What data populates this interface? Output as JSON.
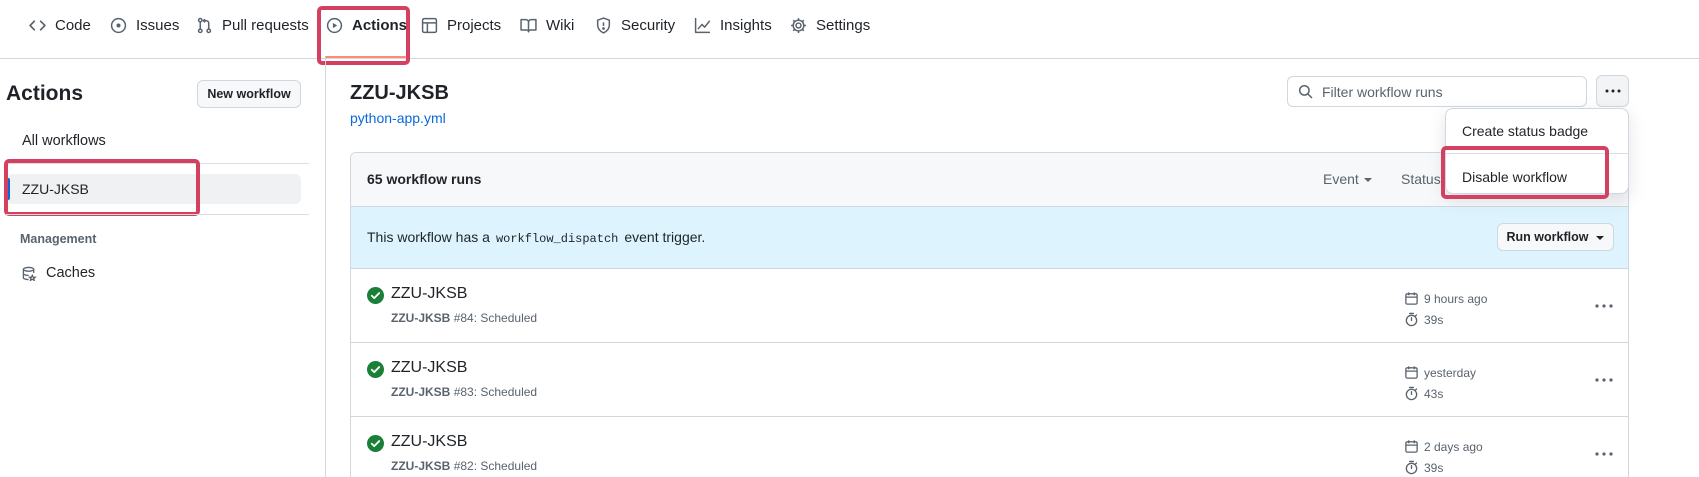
{
  "nav": {
    "tabs": [
      {
        "label": "Code",
        "icon": "code-icon"
      },
      {
        "label": "Issues",
        "icon": "issue-opened-icon"
      },
      {
        "label": "Pull requests",
        "icon": "git-pull-request-icon"
      },
      {
        "label": "Actions",
        "icon": "play-icon",
        "selected": true
      },
      {
        "label": "Projects",
        "icon": "table-icon"
      },
      {
        "label": "Wiki",
        "icon": "book-icon"
      },
      {
        "label": "Security",
        "icon": "shield-icon"
      },
      {
        "label": "Insights",
        "icon": "graph-icon"
      },
      {
        "label": "Settings",
        "icon": "gear-icon"
      }
    ]
  },
  "sidebar": {
    "title": "Actions",
    "new_workflow_label": "New workflow",
    "all_workflows_label": "All workflows",
    "workflows": [
      {
        "label": "ZZU-JKSB",
        "selected": true
      }
    ],
    "management_heading": "Management",
    "caches_label": "Caches"
  },
  "main": {
    "workflow_title": "ZZU-JKSB",
    "workflow_file": "python-app.yml",
    "filter_placeholder": "Filter workflow runs",
    "run_count": "65 workflow runs",
    "header_filters": [
      "Event",
      "Status"
    ],
    "banner": {
      "prefix": "This workflow has a",
      "code": "workflow_dispatch",
      "suffix": "event trigger.",
      "button_label": "Run workflow"
    },
    "runs": [
      {
        "title": "ZZU-JKSB",
        "workflow": "ZZU-JKSB",
        "detail": "#84: Scheduled",
        "when": "9 hours ago",
        "duration": "39s",
        "status": "success"
      },
      {
        "title": "ZZU-JKSB",
        "workflow": "ZZU-JKSB",
        "detail": "#83: Scheduled",
        "when": "yesterday",
        "duration": "43s",
        "status": "success"
      },
      {
        "title": "ZZU-JKSB",
        "workflow": "ZZU-JKSB",
        "detail": "#82: Scheduled",
        "when": "2 days ago",
        "duration": "39s",
        "status": "success"
      }
    ]
  },
  "menu": {
    "items": [
      "Create status badge",
      "Disable workflow"
    ]
  },
  "colors": {
    "accent": "#0969da",
    "success": "#1a7f37",
    "highlight": "#d4405f",
    "tab_underline": "#fd8c73",
    "banner_bg": "#ddf4ff"
  }
}
